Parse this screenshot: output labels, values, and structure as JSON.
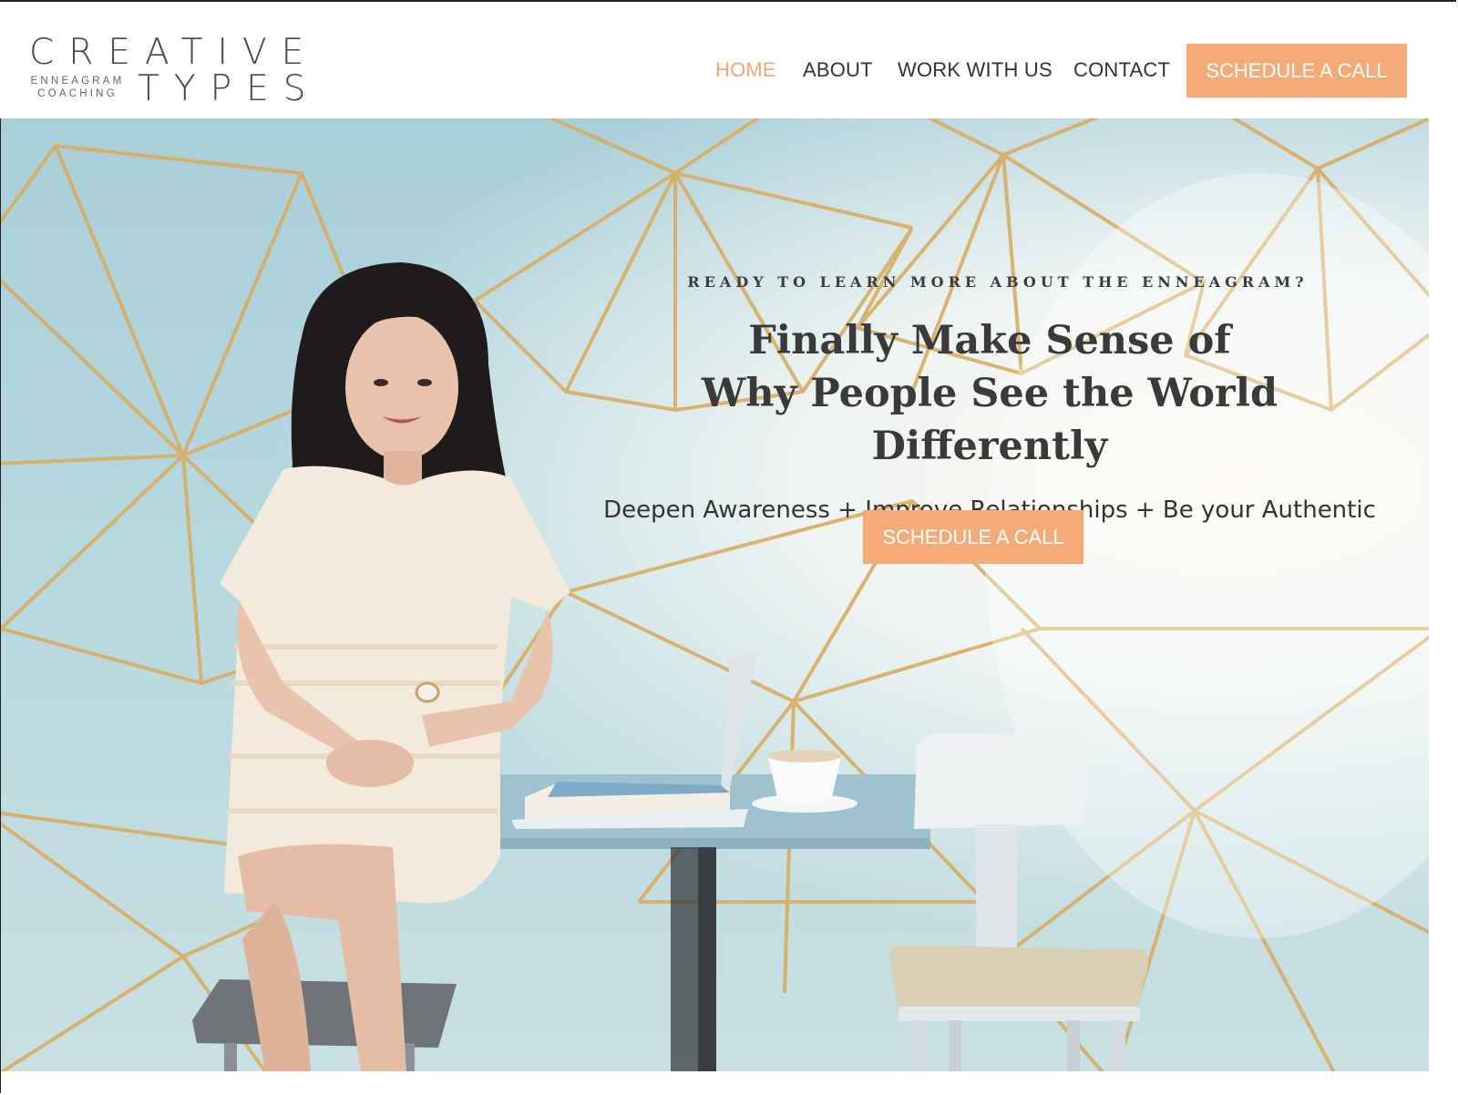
{
  "brand": {
    "name_top": "CREATIVE",
    "name_sub": "ENNEAGRAM COACHING",
    "name_bottom": "TYPES"
  },
  "nav": {
    "items": [
      {
        "label": "HOME",
        "active": true
      },
      {
        "label": "ABOUT",
        "active": false
      },
      {
        "label": "WORK WITH US",
        "active": false
      },
      {
        "label": "CONTACT",
        "active": false
      }
    ],
    "cta_label": "SCHEDULE A CALL"
  },
  "hero": {
    "eyebrow": "READY TO LEARN MORE ABOUT THE ENNEAGRAM?",
    "headline_line1": "Finally Make Sense of",
    "headline_line2": "Why People See the World Differently",
    "subline": "Deepen Awareness + Improve Relationships + Be your Authentic Self",
    "cta_label": "SCHEDULE A CALL"
  },
  "colors": {
    "accent": "#f4ab78",
    "nav_active": "#f2a66e",
    "text": "#333333",
    "hero_bg": "#b6d8df",
    "pattern_line": "#d9ad63"
  }
}
